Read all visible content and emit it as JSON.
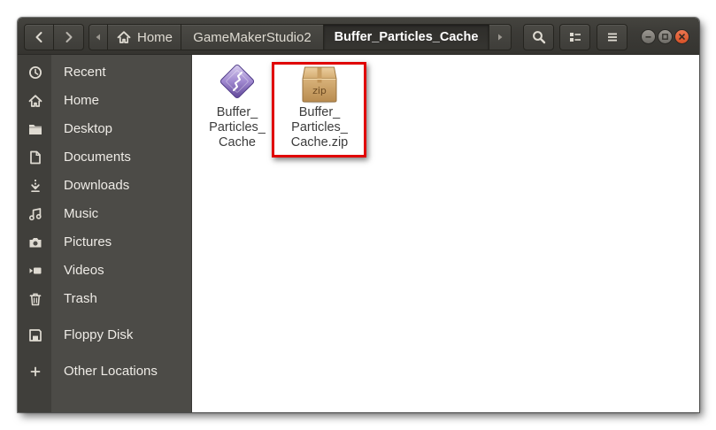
{
  "header": {
    "back_icon": "chevron-left-icon",
    "forward_icon": "chevron-right-icon",
    "path": {
      "scroll_left_icon": "pan-start-icon",
      "segments": [
        {
          "label": "Home",
          "icon": "home-icon"
        },
        {
          "label": "GameMakerStudio2"
        },
        {
          "label": "Buffer_Particles_Cache",
          "active": true
        }
      ],
      "scroll_right_icon": "pan-end-icon"
    },
    "search_icon": "search-icon",
    "view_icon": "view-list-icon",
    "menu_icon": "menu-icon",
    "window_controls": [
      "minimize-icon",
      "maximize-icon",
      "close-icon"
    ]
  },
  "sidebar": {
    "items": [
      {
        "label": "Recent",
        "icon": "clock-icon"
      },
      {
        "label": "Home",
        "icon": "home-icon"
      },
      {
        "label": "Desktop",
        "icon": "desktop-folder-icon"
      },
      {
        "label": "Documents",
        "icon": "document-icon"
      },
      {
        "label": "Downloads",
        "icon": "download-icon"
      },
      {
        "label": "Music",
        "icon": "music-icon"
      },
      {
        "label": "Pictures",
        "icon": "camera-icon"
      },
      {
        "label": "Videos",
        "icon": "video-icon"
      },
      {
        "label": "Trash",
        "icon": "trash-icon"
      },
      {
        "label": "Floppy Disk",
        "icon": "floppy-disk-icon"
      },
      {
        "label": "Other Locations",
        "icon": "plus-icon"
      }
    ]
  },
  "files": [
    {
      "name_lines": [
        "Buffer_",
        "Particles_",
        "Cache"
      ],
      "icon": "executable-icon"
    },
    {
      "name_lines": [
        "Buffer_",
        "Particles_",
        "Cache.zip"
      ],
      "icon": "zip-archive-icon",
      "icon_text": "zip",
      "highlighted": true
    }
  ],
  "colors": {
    "header_bg": "#3c3b37",
    "sidebar_bg": "#4c4b47",
    "sidebar_strip": "#403f3b",
    "content_bg": "#ffffff",
    "close_button": "#e9582a",
    "highlight_border": "#e00000"
  }
}
